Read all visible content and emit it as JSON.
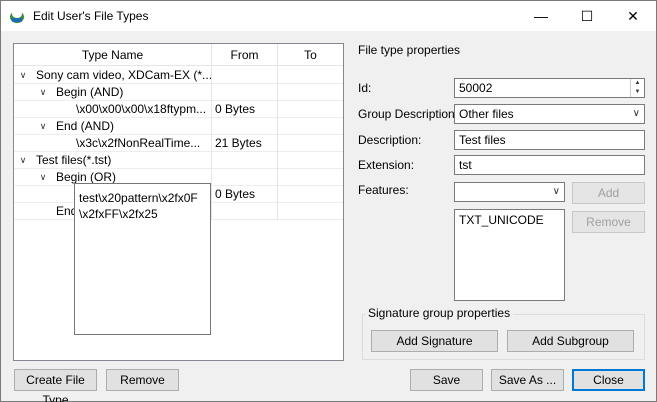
{
  "window": {
    "title": "Edit User's File Types",
    "minimize_glyph": "—",
    "maximize_glyph": "☐",
    "close_glyph": "✕",
    "icon": "app-icon"
  },
  "tree": {
    "columns": [
      "Type Name",
      "From",
      "To"
    ],
    "rows": [
      {
        "name": "Sony cam video, XDCam-EX (*...",
        "from": "",
        "level": 0,
        "expanded": true
      },
      {
        "name": "Begin (AND)",
        "from": "",
        "level": 1,
        "expanded": true
      },
      {
        "name": "\\x00\\x00\\x00\\x18ftypm...",
        "from": "0 Bytes",
        "level": 2
      },
      {
        "name": "End (AND)",
        "from": "",
        "level": 1,
        "expanded": true
      },
      {
        "name": "\\x3c\\x2fNonRealTime...",
        "from": "21 Bytes",
        "level": 2
      },
      {
        "name": "Test files(*.tst)",
        "from": "",
        "level": 0,
        "expanded": true
      },
      {
        "name": "Begin (OR)",
        "from": "",
        "level": 1,
        "expanded": true
      },
      {
        "name": "",
        "from": "0 Bytes",
        "level": 2
      },
      {
        "name": "End",
        "from": "",
        "level": 1
      }
    ],
    "tooltip": "test\\x20pattern\\x2fx0F\\x2fxFF\\x2fx25"
  },
  "properties": {
    "section_title": "File type properties",
    "id_label": "Id:",
    "id_value": "50002",
    "group_label": "Group Description:",
    "group_value": "Other files",
    "description_label": "Description:",
    "description_value": "Test files",
    "extension_label": "Extension:",
    "extension_value": "tst",
    "features_label": "Features:",
    "features_value": "",
    "features_list": [
      "TXT_UNICODE"
    ],
    "add_label": "Add",
    "remove_feature_label": "Remove"
  },
  "signature_group": {
    "title": "Signature group properties",
    "add_signature_label": "Add Signature",
    "add_subgroup_label": "Add Subgroup"
  },
  "footer": {
    "create_label": "Create File Type",
    "remove_label": "Remove",
    "save_label": "Save",
    "save_as_label": "Save As ...",
    "close_label": "Close"
  }
}
